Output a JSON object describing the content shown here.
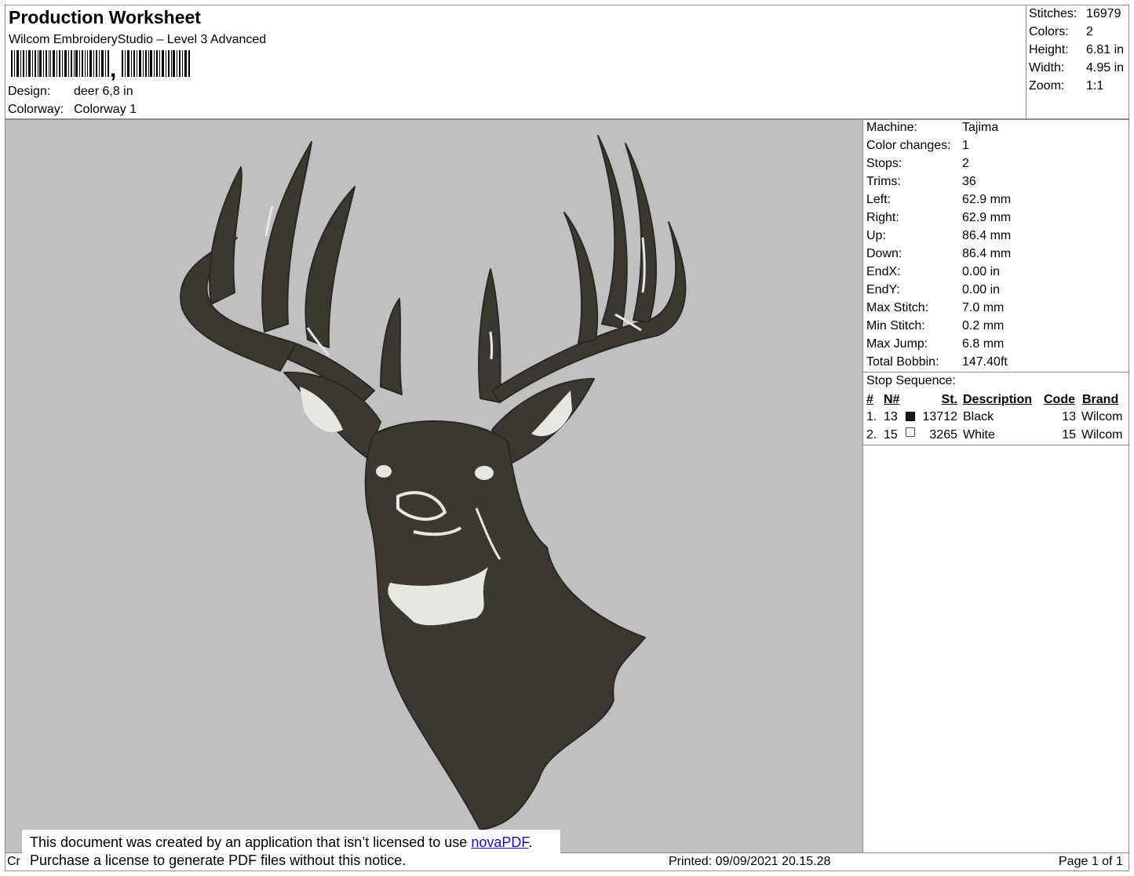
{
  "header": {
    "title": "Production Worksheet",
    "subtitle": "Wilcom EmbroideryStudio – Level 3 Advanced",
    "barcode_caption": ",",
    "design_label": "Design:",
    "design_value": "deer 6,8 in",
    "colorway_label": "Colorway:",
    "colorway_value": "Colorway 1"
  },
  "summary": [
    {
      "label": "Stitches:",
      "value": "16979"
    },
    {
      "label": "Colors:",
      "value": "2"
    },
    {
      "label": "Height:",
      "value": "6.81 in"
    },
    {
      "label": "Width:",
      "value": "4.95 in"
    },
    {
      "label": "Zoom:",
      "value": "1:1"
    }
  ],
  "machine_info": [
    {
      "label": "Machine:",
      "value": "Tajima"
    },
    {
      "label": "Color changes:",
      "value": "1"
    },
    {
      "label": "Stops:",
      "value": "2"
    },
    {
      "label": "Trims:",
      "value": "36"
    },
    {
      "label": "Left:",
      "value": "62.9 mm"
    },
    {
      "label": "Right:",
      "value": "62.9 mm"
    },
    {
      "label": "Up:",
      "value": "86.4 mm"
    },
    {
      "label": "Down:",
      "value": "86.4 mm"
    },
    {
      "label": "EndX:",
      "value": "0.00 in"
    },
    {
      "label": "EndY:",
      "value": "0.00 in"
    },
    {
      "label": "Max Stitch:",
      "value": "7.0 mm"
    },
    {
      "label": "Min Stitch:",
      "value": "0.2 mm"
    },
    {
      "label": "Max Jump:",
      "value": "6.8 mm"
    },
    {
      "label": "Total Bobbin:",
      "value": "147.40ft"
    }
  ],
  "stop_sequence": {
    "title": "Stop Sequence:",
    "headers": {
      "num": "#",
      "n": "N#",
      "st": "St.",
      "desc": "Description",
      "code": "Code",
      "brand": "Brand"
    },
    "rows": [
      {
        "num": "1.",
        "n": "13",
        "color": "#1a1a1a",
        "st": "13712",
        "desc": "Black",
        "code": "13",
        "brand": "Wilcom"
      },
      {
        "num": "2.",
        "n": "15",
        "color": "#ffffff",
        "st": "3265",
        "desc": "White",
        "code": "15",
        "brand": "Wilcom"
      }
    ]
  },
  "canvas": {
    "background": "#c0c0c0",
    "thread_dark": "#3b3832",
    "thread_light": "#e6e6e2"
  },
  "footer": {
    "created_prefix": "Cr",
    "notice_line1": "This document was created by an application that isn’t licensed to use",
    "notice_link": "novaPDF",
    "notice_period": ".",
    "notice_line2": "Purchase a license to generate PDF files without this notice.",
    "printed": "Printed: 09/09/2021 20.15.28",
    "page": "Page 1 of 1"
  }
}
